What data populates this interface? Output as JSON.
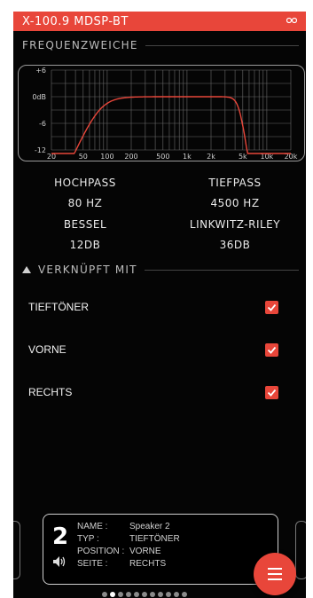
{
  "app": {
    "title": "X-100.9 MDSP-BT",
    "link_icon": "link-icon"
  },
  "crossover": {
    "section_title": "FREQUENZWEICHE",
    "graph": {
      "y_ticks": [
        "+6",
        "0dB",
        "-6",
        "-12"
      ],
      "x_ticks": [
        "20",
        "50",
        "100",
        "200",
        "500",
        "1k",
        "2k",
        "5k",
        "10k",
        "20k"
      ]
    },
    "highpass": {
      "label": "HOCHPASS",
      "freq": "80 HZ",
      "type": "BESSEL",
      "slope": "12DB"
    },
    "lowpass": {
      "label": "TIEFPASS",
      "freq": "4500 HZ",
      "type": "LINKWITZ-RILEY",
      "slope": "36DB"
    }
  },
  "linked": {
    "section_title": "VERKNÜPFT MIT",
    "items": [
      {
        "label": "TIEFTÖNER",
        "checked": true
      },
      {
        "label": "VORNE",
        "checked": true
      },
      {
        "label": "RECHTS",
        "checked": true
      }
    ]
  },
  "speaker_card": {
    "number": "2",
    "rows": [
      {
        "key": "NAME :",
        "value": "Speaker 2"
      },
      {
        "key": "TYP :",
        "value": "TIEFTÖNER"
      },
      {
        "key": "POSITION :",
        "value": "VORNE"
      },
      {
        "key": "SEITE :",
        "value": "RECHTS"
      }
    ],
    "icon": "speaker-icon"
  },
  "pager": {
    "count": 11,
    "active_index": 1
  },
  "fab": {
    "icon": "menu-icon"
  },
  "colors": {
    "accent": "#e8463a",
    "background": "#050505"
  }
}
